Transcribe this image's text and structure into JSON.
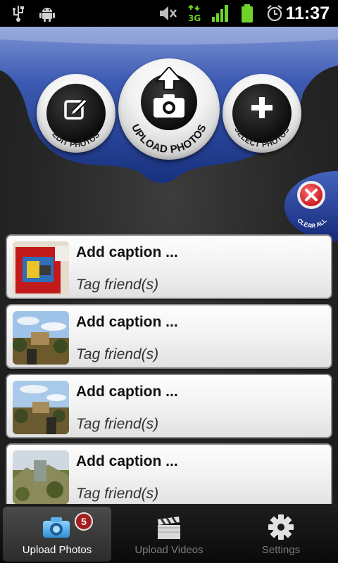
{
  "status_bar": {
    "time": "11:37",
    "icons": [
      "usb-icon",
      "android-debug-icon",
      "mute-icon",
      "network-3g-icon",
      "signal-icon",
      "battery-icon",
      "alarm-icon"
    ],
    "network_label": "3G"
  },
  "toolbar": {
    "edit_label": "EDIT PHOTOS",
    "upload_label": "UPLOAD PHOTOS",
    "select_label": "SELECT PHOTOS",
    "clear_label": "CLEAR ALL"
  },
  "items": [
    {
      "caption": "Add caption ...",
      "tag": "Tag friend(s)",
      "thumb": "photo-red-toy"
    },
    {
      "caption": "Add caption ...",
      "tag": "Tag friend(s)",
      "thumb": "photo-landscape-sky"
    },
    {
      "caption": "Add caption ...",
      "tag": "Tag friend(s)",
      "thumb": "photo-landscape-sky"
    },
    {
      "caption": "Add caption ...",
      "tag": "Tag friend(s)",
      "thumb": "photo-landscape-rocks"
    }
  ],
  "tabs": [
    {
      "label": "Upload Photos",
      "icon": "camera-icon",
      "active": true,
      "badge": "5"
    },
    {
      "label": "Upload Videos",
      "icon": "clapperboard-icon",
      "active": false
    },
    {
      "label": "Settings",
      "icon": "gear-icon",
      "active": false
    }
  ],
  "colors": {
    "brand_blue": "#1f3b8f",
    "badge_red": "#a31f1f",
    "clear_red": "#d8232a"
  }
}
